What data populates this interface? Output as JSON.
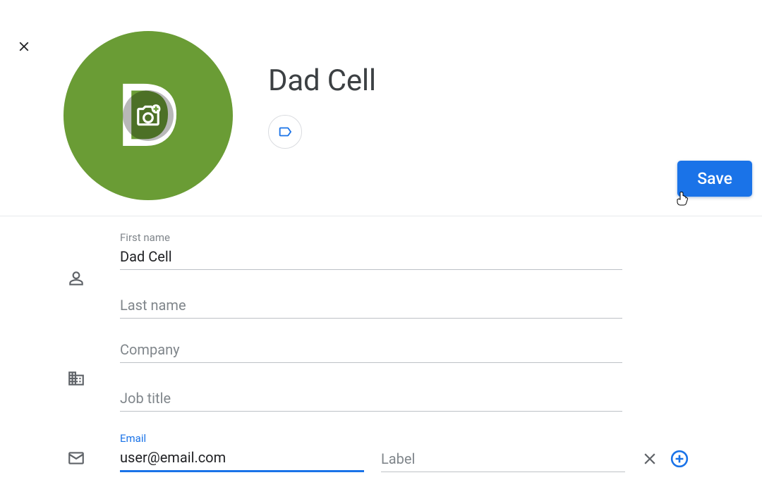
{
  "contact": {
    "display_name": "Dad Cell",
    "avatar_letter": "D",
    "avatar_color": "#6a9c35"
  },
  "actions": {
    "save_label": "Save"
  },
  "fields": {
    "first_name": {
      "label": "First name",
      "value": "Dad Cell"
    },
    "last_name": {
      "label": "Last name",
      "value": ""
    },
    "company": {
      "label": "Company",
      "value": ""
    },
    "job_title": {
      "label": "Job title",
      "value": ""
    },
    "email": {
      "label": "Email",
      "value": "user@email.com",
      "label_placeholder": "Label",
      "label_value": ""
    }
  },
  "icons": {
    "close": "close-icon",
    "camera": "camera-add-icon",
    "label": "label-icon",
    "person": "person-icon",
    "company": "building-icon",
    "email": "mail-icon",
    "clear": "clear-icon",
    "add": "add-circle-icon"
  }
}
